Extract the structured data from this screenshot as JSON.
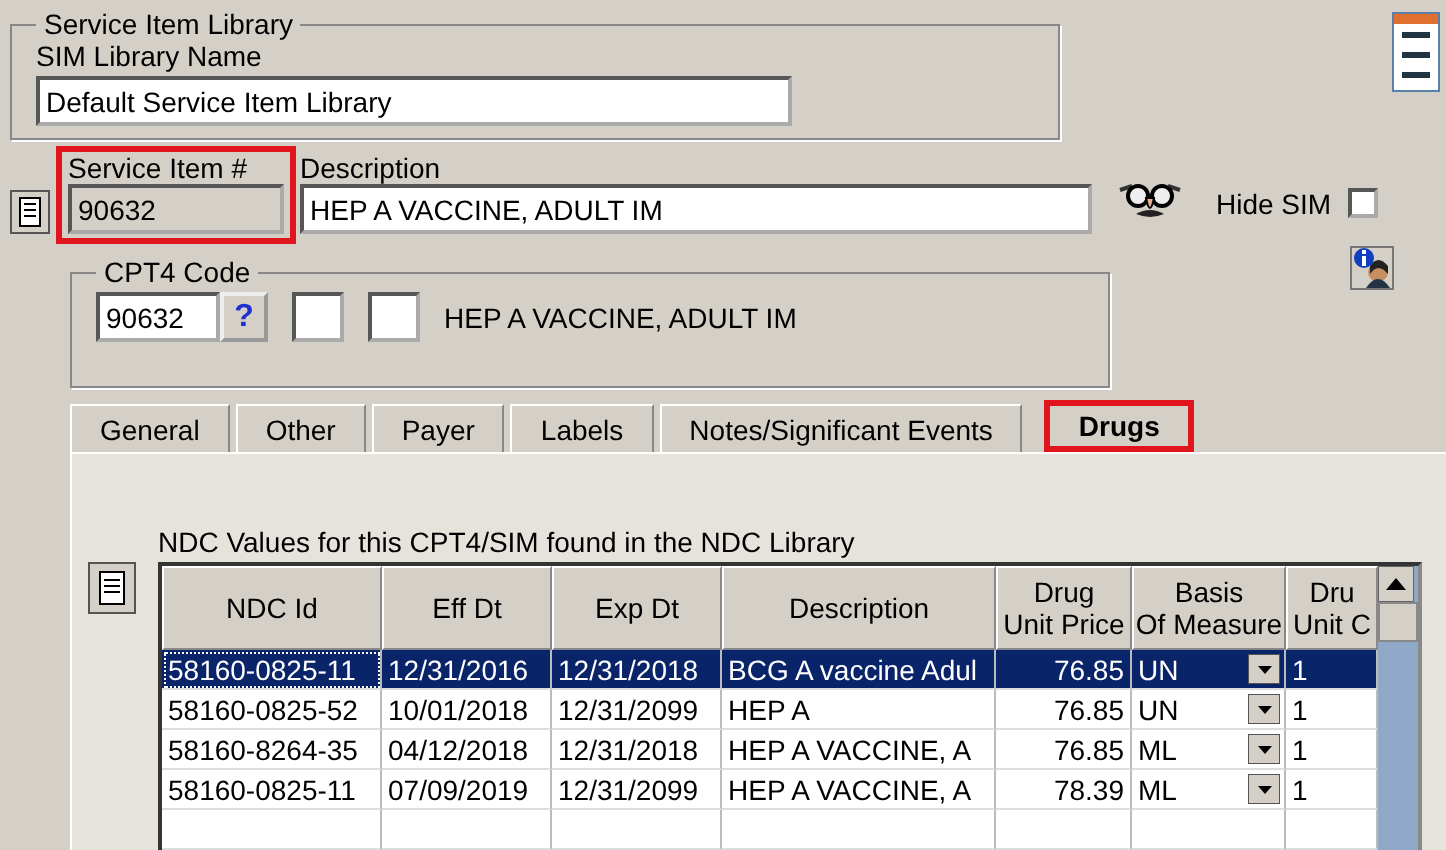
{
  "library_group": {
    "title": "Service Item Library",
    "name_label": "SIM Library Name",
    "name_value": "Default Service Item Library"
  },
  "service_item": {
    "label": "Service Item #",
    "value": "90632",
    "disabled": true,
    "highlighted": true
  },
  "description": {
    "label": "Description",
    "value": "HEP A VACCINE, ADULT IM"
  },
  "hide_sim": {
    "label": "Hide SIM",
    "checked": false
  },
  "cpt4_group": {
    "title": "CPT4 Code",
    "code": "90632",
    "help": "?",
    "description": "HEP A VACCINE, ADULT IM"
  },
  "tabs": [
    {
      "label": "General",
      "selected": false,
      "highlighted": false
    },
    {
      "label": "Other",
      "selected": false,
      "highlighted": false
    },
    {
      "label": "Payer",
      "selected": false,
      "highlighted": false
    },
    {
      "label": "Labels",
      "selected": false,
      "highlighted": false
    },
    {
      "label": "Notes/Significant Events",
      "selected": false,
      "highlighted": false
    },
    {
      "label": "Drugs",
      "selected": true,
      "highlighted": true
    }
  ],
  "ndc_caption": "NDC Values for this CPT4/SIM found in the NDC Library",
  "table": {
    "columns": [
      "NDC Id",
      "Eff Dt",
      "Exp Dt",
      "Description",
      "Drug\nUnit Price",
      "Basis\nOf Measure",
      "Dru\nUnit C"
    ],
    "rows": [
      {
        "cells": [
          "58160-0825-11",
          "12/31/2016",
          "12/31/2018",
          "BCG A vaccine Adul",
          "76.85",
          "UN",
          "1"
        ],
        "selected": true
      },
      {
        "cells": [
          "58160-0825-52",
          "10/01/2018",
          "12/31/2099",
          "HEP A",
          "76.85",
          "UN",
          "1"
        ],
        "selected": false
      },
      {
        "cells": [
          "58160-8264-35",
          "04/12/2018",
          "12/31/2018",
          "HEP A VACCINE, A",
          "76.85",
          "ML",
          "1"
        ],
        "selected": false
      },
      {
        "cells": [
          "58160-0825-11",
          "07/09/2019",
          "12/31/2099",
          "HEP A VACCINE, A",
          "78.39",
          "ML",
          "1"
        ],
        "selected": false
      }
    ]
  }
}
